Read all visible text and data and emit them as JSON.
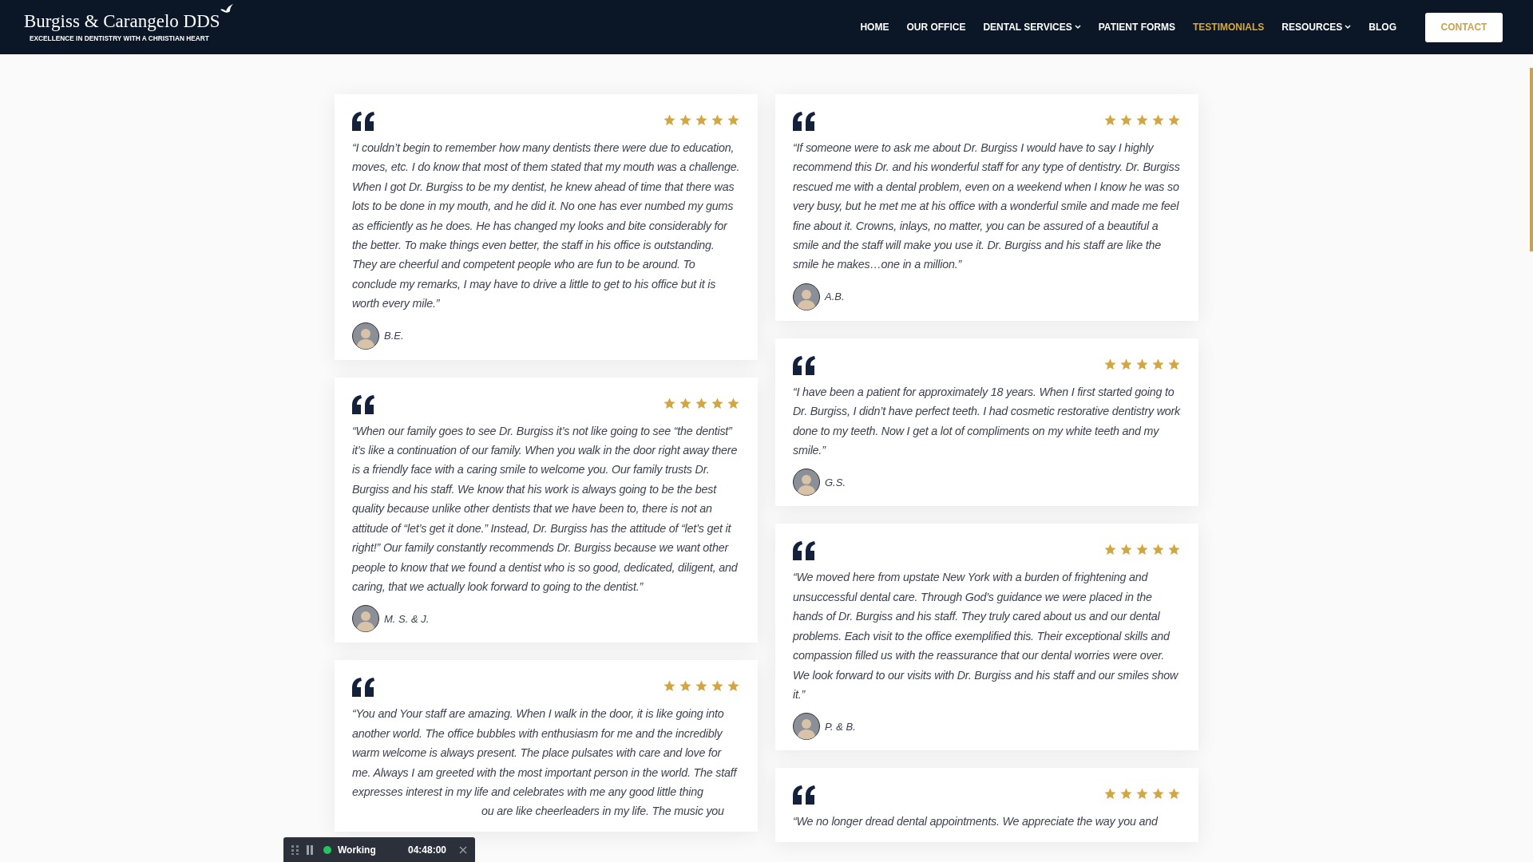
{
  "header": {
    "logo_title": "Burgiss & Carangelo DDS",
    "logo_tagline": "EXCELLENCE IN DENTISTRY WITH A CHRISTIAN HEART",
    "nav": [
      {
        "label": "HOME",
        "selected": false,
        "dropdown": false
      },
      {
        "label": "OUR OFFICE",
        "selected": false,
        "dropdown": false
      },
      {
        "label": "DENTAL SERVICES",
        "selected": false,
        "dropdown": true
      },
      {
        "label": "PATIENT FORMS",
        "selected": false,
        "dropdown": false
      },
      {
        "label": "TESTIMONIALS",
        "selected": true,
        "dropdown": false
      },
      {
        "label": "RESOURCES",
        "selected": false,
        "dropdown": true
      },
      {
        "label": "BLOG",
        "selected": false,
        "dropdown": false
      }
    ],
    "contact_button": "CONTACT"
  },
  "columns": [
    [
      {
        "stars": 5,
        "quote": "“I couldn’t begin to remember how many dentists there were due to education, moves, etc. I do know that most of them stated that my mouth was a challenge. When I got Dr. Burgiss to be my dentist, he knew ahead of time that there was lots to be done in my mouth, and he did it. No one has ever numbed my gums as efficiently as he does. He has changed my looks and bite considerably for the better. To make things even better, the staff in his office is outstanding. They are cheerful and competent people who are fun to be around. To conclude my remarks, I may have to drive a little to get to his office but it is worth every mile.”",
        "author": "B.E."
      },
      {
        "stars": 5,
        "quote": "“When our family goes to see Dr. Burgiss it’s not like going to see “the dentist” it’s like a continuation of our family. When you walk in the door right away there is a friendly face with a caring smile to welcome you. Our family trusts Dr. Burgiss and his staff. We know that his work is always going to be the best quality because unlike other dentists that we have been to, there is not an attitude of “let’s get it done.” Instead, Dr. Burgiss has the attitude of “let’s get it right!” Our family constantly recommends Dr. Burgiss because we want other people to know that we found a dentist who is so good, dedicated, diligent, and caring, that we actually look forward to going to the dentist.”",
        "author": "M. S. & J."
      },
      {
        "stars": 5,
        "quote": "“You and Your staff are amazing. When I walk in the door, it is like going into another world. The office bubbles with enthusiasm for me and the incredibly warm welcome is always present. The place pulsates with care and love for me. Always I am greeted with the most important person in the world. The staff expresses interest in my life and celebrates with me any good little thing",
        "quote_tail": "ou are like cheerleaders in my life. The music you"
      }
    ],
    [
      {
        "stars": 5,
        "quote": "“If someone were to ask me about Dr. Burgiss I would have to say I highly recommend this Dr. and his wonderful staff for any type of dentistry. Dr. Burgiss rescued me with a dental problem, even on a weekend when I know he was so very busy, but he met me at his office with a wonderful smile and made me feel fine about it. Crowns, inlays, no matter, you can be assured of a beautiful a smile and the staff will make you use it. Dr. Burgiss and his staff are like the smile he makes…one in a million.”",
        "author": "A.B."
      },
      {
        "stars": 5,
        "quote": "“I have been a patient for approximately 18 years. When I first started going to Dr. Burgiss, I didn’t have perfect teeth. I had cosmetic restorative dentistry work done to my teeth. Now I get a lot of compliments on my white teeth and my smile.”",
        "author": "G.S."
      },
      {
        "stars": 5,
        "quote": "“We moved here from upstate New York with a burden of frightening and unsuccessful dental care. Through God’s guidance we were placed in the hands of Dr. Burgiss and his staff. They truly cared about us and our dental problems. Each visit to the office exemplified this. Their exceptional skills and compassion filled us with the reassurance that our dental worries were over. We look forward to our visits with Dr. Burgiss and his staff and our smiles show it.”",
        "author": "P. & B."
      },
      {
        "stars": 5,
        "quote": "“We no longer dread dental appointments. We appreciate the way you and"
      }
    ]
  ],
  "timer_bar": {
    "status": "Working",
    "time": "04:48:00"
  }
}
